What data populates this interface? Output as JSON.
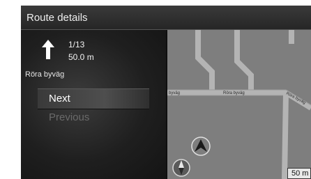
{
  "header": {
    "title": "Route details"
  },
  "guidance": {
    "arrow_icon": "straight-arrow-icon",
    "step": "1/13",
    "distance": "50.0 m",
    "road_name": "Röra byväg"
  },
  "menu": {
    "next_label": "Next",
    "previous_label": "Previous"
  },
  "map": {
    "road_labels": [
      "byväg",
      "Röra byväg",
      "Röra byväg"
    ],
    "scale_label": "50 m",
    "icons": [
      "compass-icon",
      "position-arrow-icon"
    ]
  }
}
